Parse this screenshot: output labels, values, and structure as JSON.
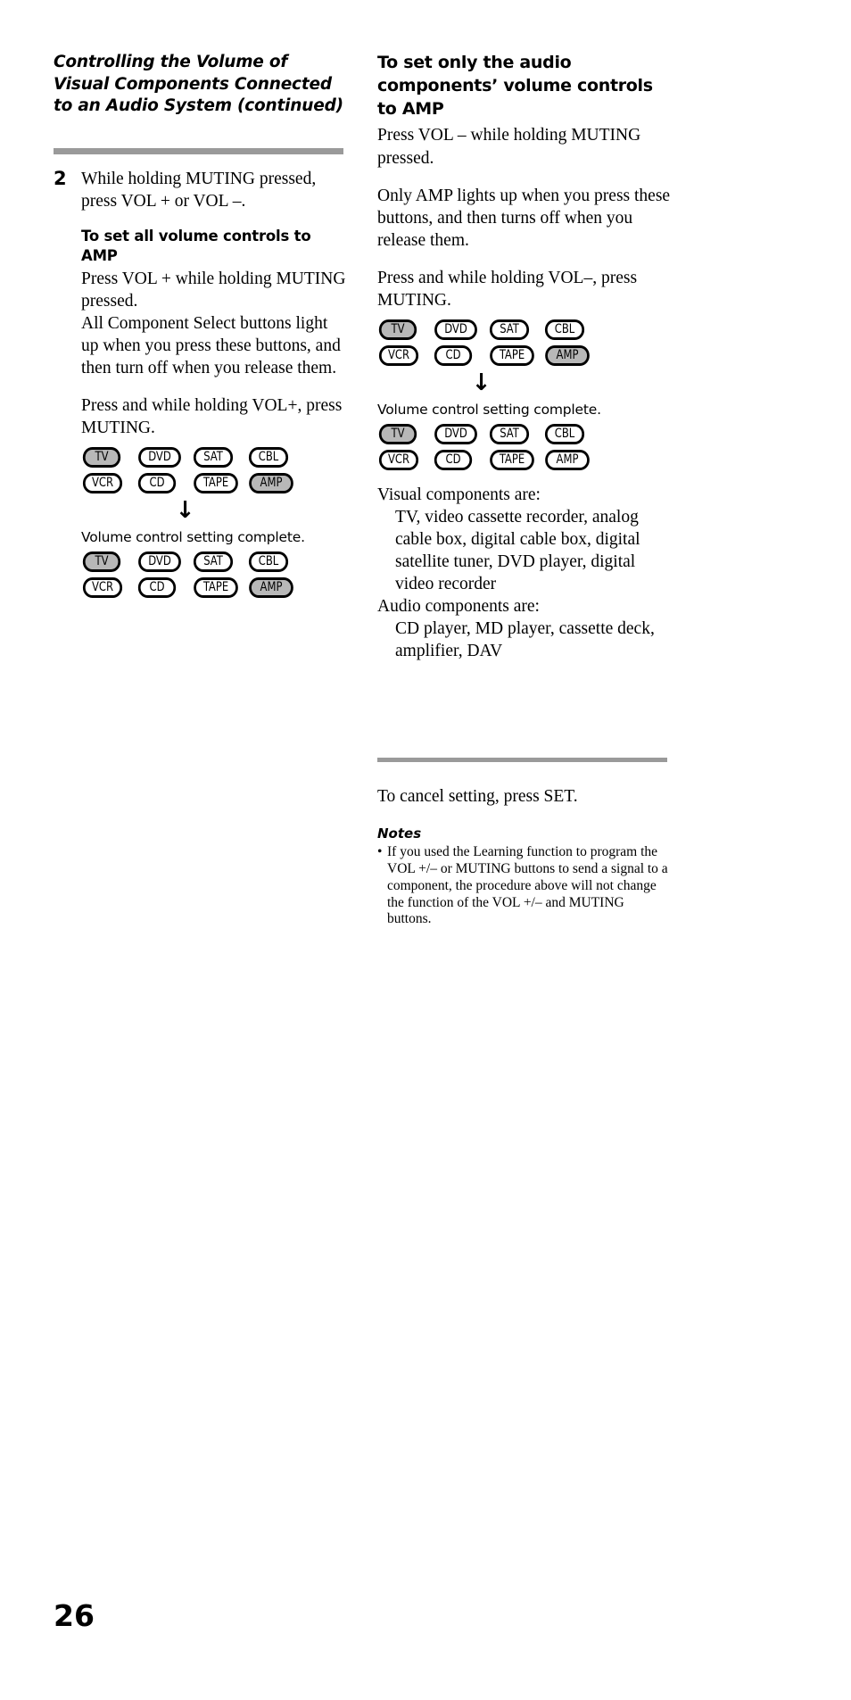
{
  "page_number": "26",
  "accent": {
    "rule_gray": "#9a9a9a",
    "pill_active_gray": "#b8b8b8"
  },
  "left": {
    "continued_header": "Controlling the Volume of Visual Components Connected to an Audio System (continued)",
    "step_number": "2",
    "step_text": "While holding MUTING pressed, press VOL + or VOL –.",
    "subhead": "To set all volume controls to AMP",
    "para1": "Press VOL + while holding MUTING pressed.",
    "para2": "All Component Select buttons light up when you press these buttons, and then turn off when you release them.",
    "para3": "Press and while holding VOL+, press MUTING.",
    "caption": "Volume control setting complete.",
    "diagram1": {
      "row1": [
        {
          "label": "TV",
          "active": true
        },
        {
          "label": "DVD",
          "active": false
        },
        {
          "label": "SAT",
          "active": false
        },
        {
          "label": "CBL",
          "active": false
        }
      ],
      "row2": [
        {
          "label": "VCR",
          "active": false
        },
        {
          "label": "CD",
          "active": false
        },
        {
          "label": "TAPE",
          "active": false
        },
        {
          "label": "AMP",
          "active": true
        }
      ]
    },
    "arrow": "↓",
    "diagram2": {
      "row1": [
        {
          "label": "TV",
          "active": true
        },
        {
          "label": "DVD",
          "active": false
        },
        {
          "label": "SAT",
          "active": false
        },
        {
          "label": "CBL",
          "active": false
        }
      ],
      "row2": [
        {
          "label": "VCR",
          "active": false
        },
        {
          "label": "CD",
          "active": false
        },
        {
          "label": "TAPE",
          "active": false
        },
        {
          "label": "AMP",
          "active": true
        }
      ]
    }
  },
  "right": {
    "section_head": "To set only the audio components’ volume controls to AMP",
    "para1": "Press VOL – while holding MUTING pressed.",
    "para2": "Only AMP lights up when you press these buttons, and then turns off when you release them.",
    "para3": "Press and while holding VOL–, press MUTING.",
    "caption": "Volume control setting complete.",
    "diagram1": {
      "row1": [
        {
          "label": "TV",
          "active": true
        },
        {
          "label": "DVD",
          "active": false
        },
        {
          "label": "SAT",
          "active": false
        },
        {
          "label": "CBL",
          "active": false
        }
      ],
      "row2": [
        {
          "label": "VCR",
          "active": false
        },
        {
          "label": "CD",
          "active": false
        },
        {
          "label": "TAPE",
          "active": false
        },
        {
          "label": "AMP",
          "active": true
        }
      ]
    },
    "arrow": "↓",
    "diagram2": {
      "row1": [
        {
          "label": "TV",
          "active": true
        },
        {
          "label": "DVD",
          "active": false
        },
        {
          "label": "SAT",
          "active": false
        },
        {
          "label": "CBL",
          "active": false
        }
      ],
      "row2": [
        {
          "label": "VCR",
          "active": false
        },
        {
          "label": "CD",
          "active": false
        },
        {
          "label": "TAPE",
          "active": false
        },
        {
          "label": "AMP",
          "active": false
        }
      ]
    },
    "visual_label": "Visual components are:",
    "visual_items": "TV, video cassette recorder, analog cable box, digital cable box, digital satellite tuner, DVD player, digital video recorder",
    "audio_label": "Audio components are:",
    "audio_items": "CD player, MD player, cassette deck, amplifier, DAV",
    "cancel_text": "To cancel setting, press SET.",
    "notes_head": "Notes",
    "note_bullet": "•",
    "note_text": "If you used the Learning function to program the VOL +/– or MUTING buttons to send a signal to a component, the procedure above will not change the function of the VOL +/– and MUTING buttons."
  }
}
